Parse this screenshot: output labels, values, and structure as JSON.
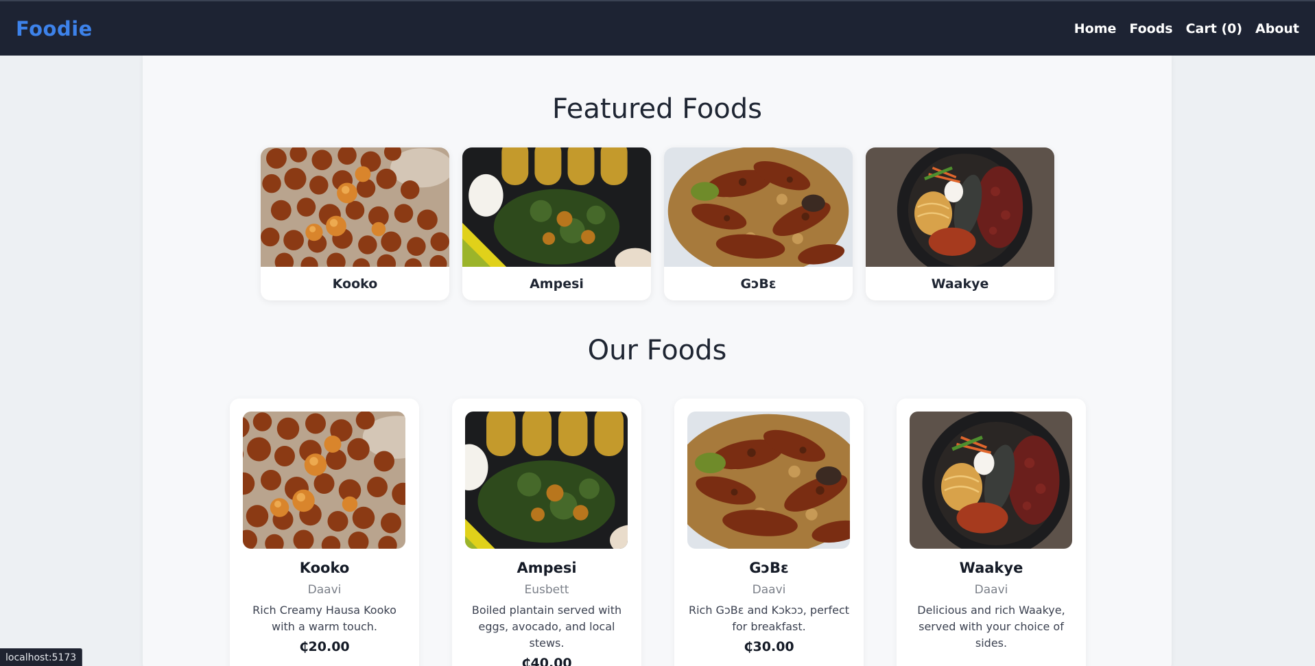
{
  "brand": {
    "label": "Foodie",
    "color": "#3d82ea"
  },
  "nav": [
    {
      "label": "Home"
    },
    {
      "label": "Foods"
    },
    {
      "label": "Cart (0)"
    },
    {
      "label": "About"
    }
  ],
  "featured": {
    "title": "Featured Foods",
    "items": [
      {
        "name": "Kooko"
      },
      {
        "name": "Ampesi"
      },
      {
        "name": "GɔBɛ"
      },
      {
        "name": "Waakye"
      }
    ]
  },
  "foods": {
    "title": "Our Foods",
    "items": [
      {
        "name": "Kooko",
        "vendor": "Daavi",
        "description": "Rich Creamy Hausa Kooko with a warm touch.",
        "price": "₵20.00"
      },
      {
        "name": "Ampesi",
        "vendor": "Eusbett",
        "description": "Boiled plantain served with eggs, avocado, and local stews.",
        "price": "₵40.00"
      },
      {
        "name": "GɔBɛ",
        "vendor": "Daavi",
        "description": "Rich GɔBɛ and Kɔkɔɔ, perfect for breakfast.",
        "price": "₵30.00"
      },
      {
        "name": "Waakye",
        "vendor": "Daavi",
        "description": "Delicious and rich Waakye, served with your choice of sides.",
        "price": ""
      }
    ]
  },
  "status_url": "localhost:5173",
  "colors": {
    "navbar_bg": "#1d2333",
    "page_bg": "#edf0f3",
    "card_bg": "#ffffff"
  }
}
